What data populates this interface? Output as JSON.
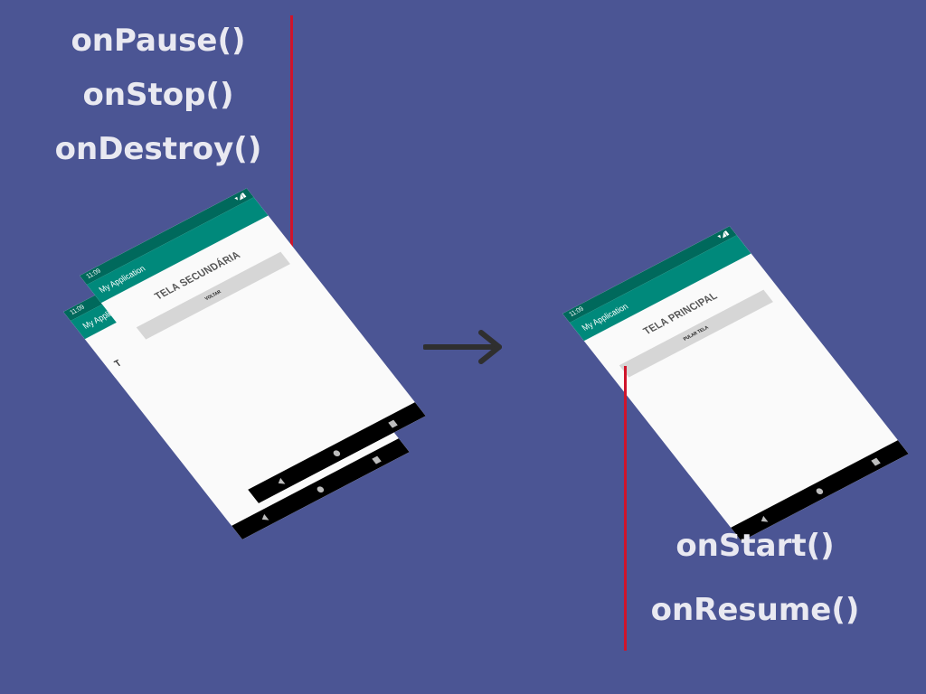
{
  "left_labels": [
    "onPause()",
    "onStop()",
    "onDestroy()"
  ],
  "right_labels": [
    "onStart()",
    "onResume()"
  ],
  "colors": {
    "background": "#4b5594",
    "line": "#d0142b",
    "toolbar": "#00897b",
    "statusbar": "#00695c"
  },
  "phone_back": {
    "time": "11:09",
    "app_title": "My Application",
    "content_initial": "T"
  },
  "phone_secondary": {
    "time": "11:09",
    "app_title": "My Application",
    "screen_title": "TELA SECUNDÁRIA",
    "button_label": "VOLTAR"
  },
  "phone_main": {
    "time": "11:09",
    "app_title": "My Application",
    "screen_title": "TELA PRINCIPAL",
    "button_label": "PULAR TELA"
  },
  "arrow_icon": "arrow-right-icon"
}
